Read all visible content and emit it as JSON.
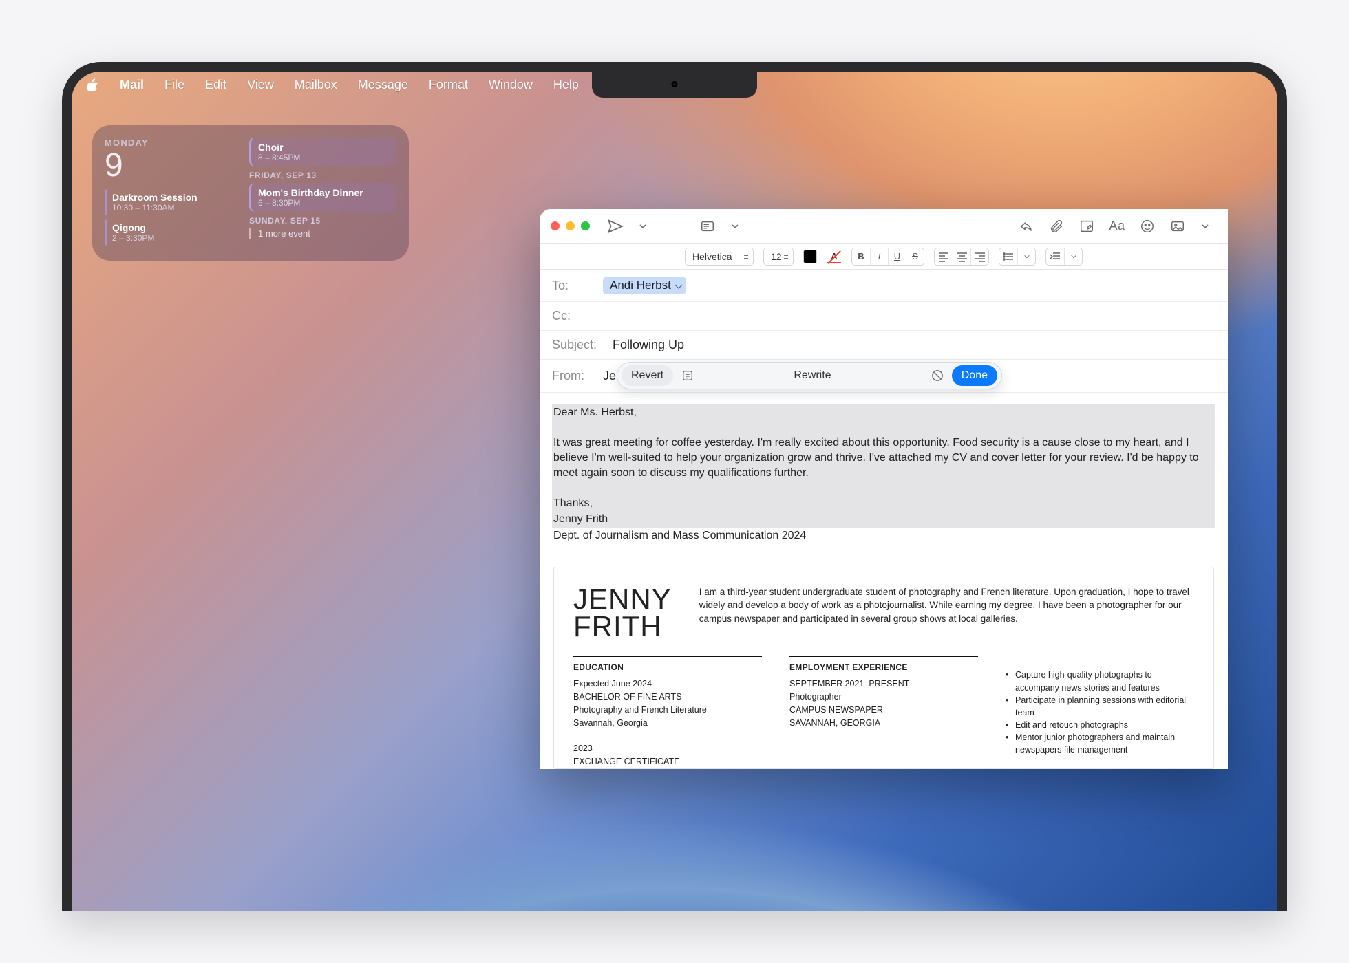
{
  "menubar": {
    "app": "Mail",
    "items": [
      "File",
      "Edit",
      "View",
      "Mailbox",
      "Message",
      "Format",
      "Window",
      "Help"
    ]
  },
  "calendar_widget": {
    "day_of_week": "MONDAY",
    "day_number": "9",
    "left_events": [
      {
        "title": "Darkroom Session",
        "time": "10:30 – 11:30AM",
        "color": "#a88fd6"
      },
      {
        "title": "Qigong",
        "time": "2 – 3:30PM",
        "color": "#a88fd6"
      }
    ],
    "right": [
      {
        "type": "event",
        "title": "Choir",
        "time": "8 – 8:45PM",
        "color": "#b79de0"
      },
      {
        "type": "date",
        "label": "FRIDAY, SEP 13"
      },
      {
        "type": "event",
        "title": "Mom's Birthday Dinner",
        "time": "6 – 8:30PM",
        "color": "#b79de0"
      },
      {
        "type": "date",
        "label": "SUNDAY, SEP 15"
      },
      {
        "type": "more",
        "label": "1 more event"
      }
    ]
  },
  "mail": {
    "format": {
      "font": "Helvetica",
      "size": "12"
    },
    "fields": {
      "to_label": "To:",
      "to_value": "Andi Herbst",
      "cc_label": "Cc:",
      "subject_label": "Subject:",
      "subject_value": "Following Up",
      "from_label": "From:",
      "from_value": "Jenny Fri"
    },
    "writing_tools": {
      "revert": "Revert",
      "title": "Rewrite",
      "done": "Done"
    },
    "body": {
      "greeting": "Dear Ms. Herbst,",
      "p1": "It was great meeting for coffee yesterday. I'm really excited about this opportunity. Food security is a cause close to my heart, and I believe I'm well-suited to help your organization grow and thrive. I've attached my CV and cover letter for your review. I'd be happy to meet again soon to discuss my qualifications further.",
      "thanks": "Thanks,",
      "sig_name": "Jenny Frith",
      "sig_dept": "Dept. of Journalism and Mass Communication 2024"
    },
    "resume": {
      "name_first": "JENNY",
      "name_last": "FRITH",
      "bio": "I am a third-year student undergraduate student of photography and French literature. Upon graduation, I hope to travel widely and develop a body of work as a photojournalist. While earning my degree, I have been a photographer for our campus newspaper and participated in several group shows at local galleries.",
      "education_hdr": "EDUCATION",
      "education": [
        "Expected June 2024",
        "BACHELOR OF FINE ARTS",
        "Photography and French Literature",
        "Savannah, Georgia",
        "",
        "2023",
        "EXCHANGE CERTIFICATE"
      ],
      "employment_hdr": "EMPLOYMENT EXPERIENCE",
      "employment": [
        "SEPTEMBER 2021–PRESENT",
        "Photographer",
        "CAMPUS NEWSPAPER",
        "SAVANNAH, GEORGIA"
      ],
      "bullets": [
        "Capture high-quality photographs to accompany news stories and features",
        "Participate in planning sessions with editorial team",
        "Edit and retouch photographs",
        "Mentor junior photographers and maintain newspapers file management"
      ]
    }
  }
}
